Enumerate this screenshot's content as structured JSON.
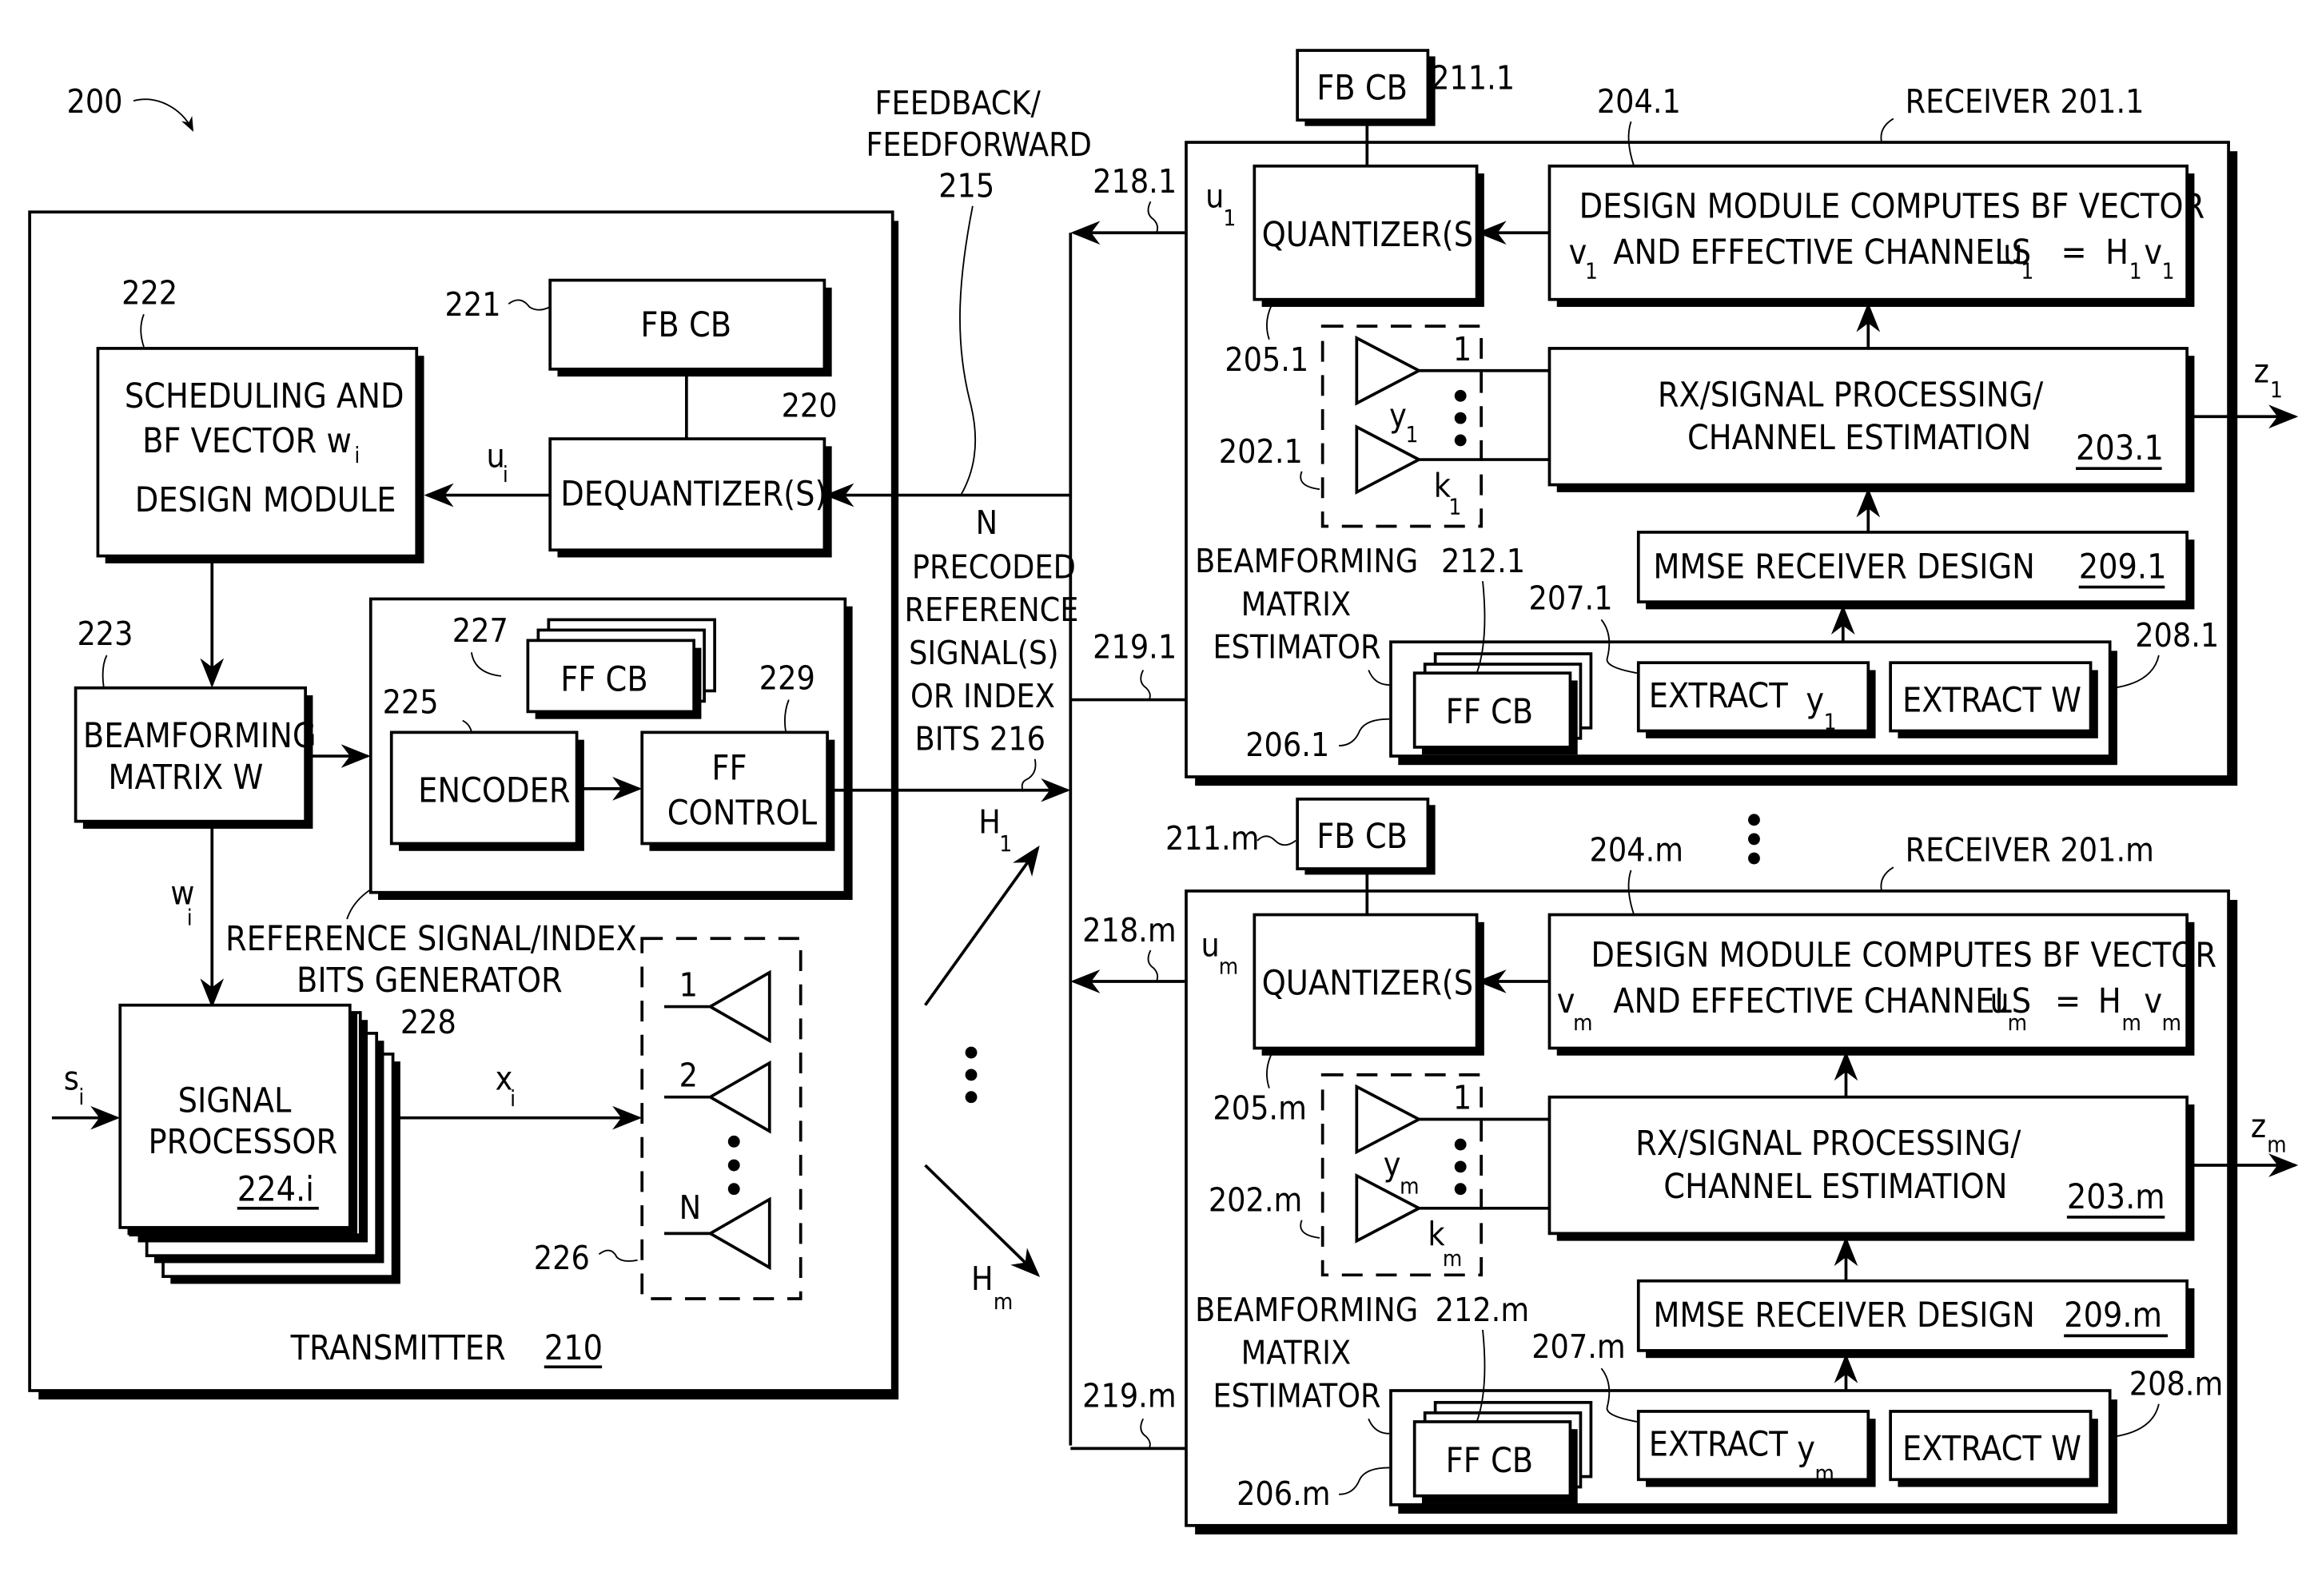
{
  "figure": {
    "number": "200",
    "feedback_label": [
      "FEEDBACK/",
      "FEEDFORWARD",
      "215"
    ],
    "middle_label": [
      "N",
      "PRECODED",
      "REFERENCE",
      "SIGNAL(S)",
      "OR INDEX",
      "BITS 216"
    ],
    "channel_h1": "H",
    "channel_h1_sub": "1",
    "channel_hm": "H",
    "channel_hm_sub": "m"
  },
  "transmitter": {
    "title": "TRANSMITTER",
    "ref": "210",
    "fbcb": {
      "ref": "221",
      "label": "FB CB"
    },
    "dequantizer": {
      "ref": "220",
      "label": "DEQUANTIZER(S)"
    },
    "scheduling": {
      "ref": "222",
      "lines": [
        "SCHEDULING AND",
        "BF VECTOR w",
        "DESIGN MODULE"
      ],
      "sub": "i"
    },
    "u_signal": "u",
    "u_sub": "i",
    "beamforming": {
      "ref": "223",
      "lines": [
        "BEAMFORMING",
        "MATRIX W"
      ]
    },
    "w_signal": "w",
    "w_sub": "i",
    "ref_generator": {
      "ref": "228",
      "lines": [
        "REFERENCE SIGNAL/INDEX",
        "BITS GENERATOR"
      ]
    },
    "ffcb": {
      "ref": "227",
      "label": "FF CB"
    },
    "encoder": {
      "ref": "225",
      "label": "ENCODER"
    },
    "ff_control": {
      "ref": "229",
      "lines": [
        "FF",
        "CONTROL"
      ]
    },
    "signal_processor": {
      "ref": "224.i",
      "lines": [
        "SIGNAL",
        "PROCESSOR"
      ]
    },
    "s_signal": "s",
    "s_sub": "i",
    "x_signal": "x",
    "x_sub": "i",
    "antennas": {
      "ref": "226",
      "labels": [
        "1",
        "2",
        "N"
      ]
    }
  },
  "receivers": [
    {
      "title": "RECEIVER 201.1",
      "fbcb": {
        "ref": "211.1",
        "label": "FB CB"
      },
      "design_ref": "204.1",
      "design_lines": [
        "DESIGN MODULE COMPUTES BF VECTOR",
        "AND EFFECTIVE CHANNELS"
      ],
      "v": "v",
      "u": "u",
      "H": "H",
      "idx": "1",
      "quantizer": {
        "label": "QUANTIZER(S)",
        "ref": "205.1"
      },
      "feedback_ref": "218.1",
      "antenna_ref": "202.1",
      "ant_top": "1",
      "y": "y",
      "k": "k",
      "rx": {
        "lines": [
          "RX/SIGNAL PROCESSING/",
          "CHANNEL ESTIMATION"
        ],
        "ref": "203.1"
      },
      "z": "z",
      "mmse": {
        "label": "MMSE RECEIVER DESIGN",
        "ref": "209.1"
      },
      "bme": {
        "lines": [
          "BEAMFORMING",
          "MATRIX",
          "ESTIMATOR"
        ],
        "ref": "206.1"
      },
      "ffcb": {
        "label": "FF CB",
        "ref": "212.1"
      },
      "extract_y": {
        "label": "EXTRACT",
        "ref": "207.1"
      },
      "extract_w": {
        "label": "EXTRACT W",
        "ref": "208.1"
      },
      "ff_ref": "219.1"
    },
    {
      "title": "RECEIVER 201.m",
      "fbcb": {
        "ref": "211.m",
        "label": "FB CB"
      },
      "design_ref": "204.m",
      "design_lines": [
        "DESIGN MODULE COMPUTES BF VECTOR",
        "AND EFFECTIVE CHANNELS"
      ],
      "v": "v",
      "u": "u",
      "H": "H",
      "idx": "m",
      "quantizer": {
        "label": "QUANTIZER(S)",
        "ref": "205.m"
      },
      "feedback_ref": "218.m",
      "antenna_ref": "202.m",
      "ant_top": "1",
      "y": "y",
      "k": "k",
      "rx": {
        "lines": [
          "RX/SIGNAL PROCESSING/",
          "CHANNEL ESTIMATION"
        ],
        "ref": "203.m"
      },
      "z": "z",
      "mmse": {
        "label": "MMSE RECEIVER DESIGN",
        "ref": "209.m"
      },
      "bme": {
        "lines": [
          "BEAMFORMING",
          "MATRIX",
          "ESTIMATOR"
        ],
        "ref": "206.m"
      },
      "ffcb": {
        "label": "FF CB",
        "ref": "212.m"
      },
      "extract_y": {
        "label": "EXTRACT",
        "ref": "207.m"
      },
      "extract_w": {
        "label": "EXTRACT W",
        "ref": "208.m"
      },
      "ff_ref": "219.m"
    }
  ]
}
